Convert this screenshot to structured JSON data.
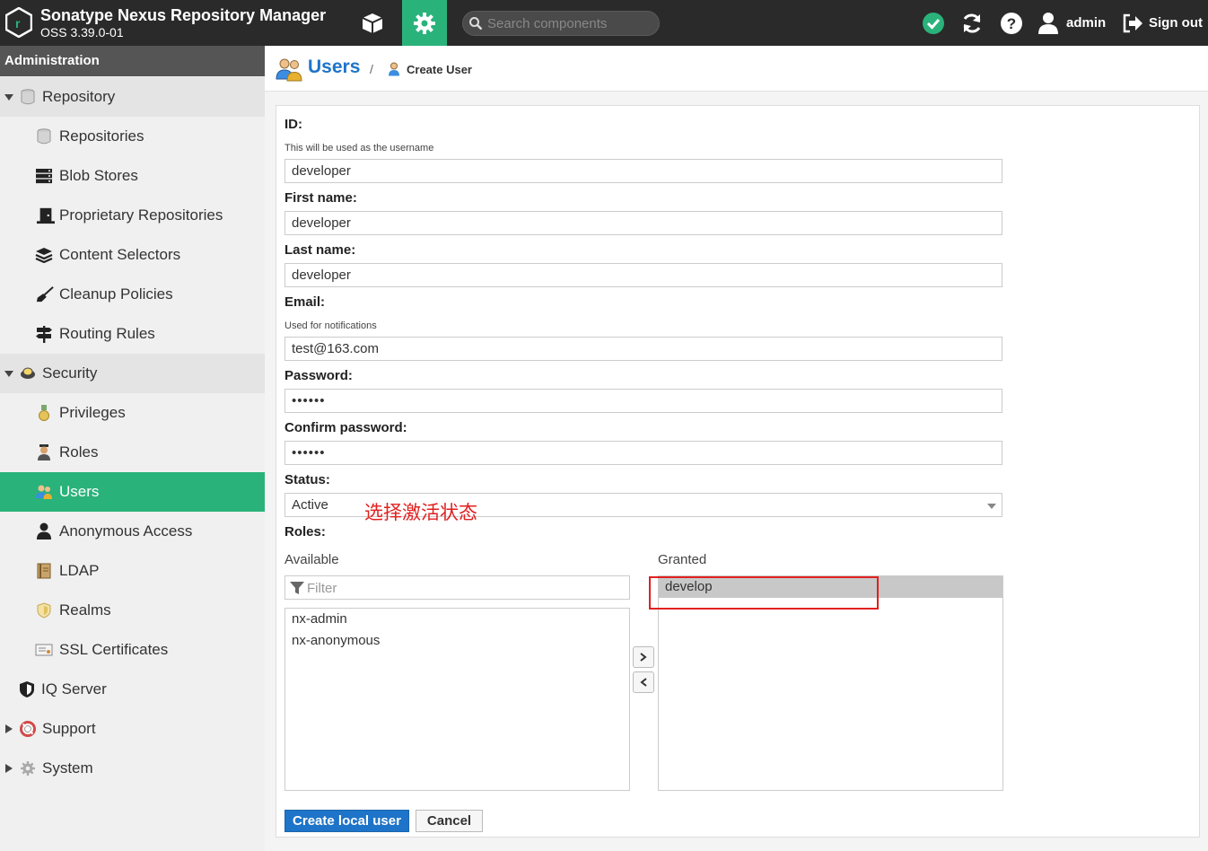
{
  "header": {
    "title": "Sonatype Nexus Repository Manager",
    "version": "OSS 3.39.0-01",
    "search_placeholder": "Search components",
    "username": "admin",
    "signout_label": "Sign out"
  },
  "sidebar": {
    "title": "Administration",
    "items": [
      {
        "label": "Repository",
        "icon": "database-icon"
      },
      {
        "label": "Repositories",
        "icon": "database-icon"
      },
      {
        "label": "Blob Stores",
        "icon": "server-icon"
      },
      {
        "label": "Proprietary Repositories",
        "icon": "door-icon"
      },
      {
        "label": "Content Selectors",
        "icon": "layers-icon"
      },
      {
        "label": "Cleanup Policies",
        "icon": "broom-icon"
      },
      {
        "label": "Routing Rules",
        "icon": "signpost-icon"
      },
      {
        "label": "Security",
        "icon": "badge-icon"
      },
      {
        "label": "Privileges",
        "icon": "medal-icon"
      },
      {
        "label": "Roles",
        "icon": "role-icon"
      },
      {
        "label": "Users",
        "icon": "users-icon"
      },
      {
        "label": "Anonymous Access",
        "icon": "person-icon"
      },
      {
        "label": "LDAP",
        "icon": "book-icon"
      },
      {
        "label": "Realms",
        "icon": "shield-icon"
      },
      {
        "label": "SSL Certificates",
        "icon": "certificate-icon"
      },
      {
        "label": "IQ Server",
        "icon": "iq-shield-icon"
      },
      {
        "label": "Support",
        "icon": "lifebuoy-icon"
      },
      {
        "label": "System",
        "icon": "gear-icon"
      }
    ]
  },
  "breadcrumb": {
    "section": "Users",
    "separator": "/",
    "page": "Create User"
  },
  "form": {
    "id_label": "ID:",
    "id_help": "This will be used as the username",
    "id_value": "developer",
    "first_name_label": "First name:",
    "first_name_value": "developer",
    "last_name_label": "Last name:",
    "last_name_value": "developer",
    "email_label": "Email:",
    "email_help": "Used for notifications",
    "email_value": "test@163.com",
    "password_label": "Password:",
    "password_value": "••••••",
    "confirm_password_label": "Confirm password:",
    "confirm_password_value": "••••••",
    "status_label": "Status:",
    "status_value": "Active",
    "roles_label": "Roles:",
    "available_label": "Available",
    "filter_placeholder": "Filter",
    "available_roles": [
      "nx-admin",
      "nx-anonymous"
    ],
    "granted_label": "Granted",
    "granted_roles": [
      "develop"
    ],
    "submit_label": "Create local user",
    "cancel_label": "Cancel"
  },
  "annotation": {
    "text": "选择激活状态"
  },
  "colors": {
    "header_bg": "#2a2a2a",
    "accent_green": "#2ab27b",
    "link_blue": "#1e74c8",
    "annotation_red": "#e02020"
  }
}
